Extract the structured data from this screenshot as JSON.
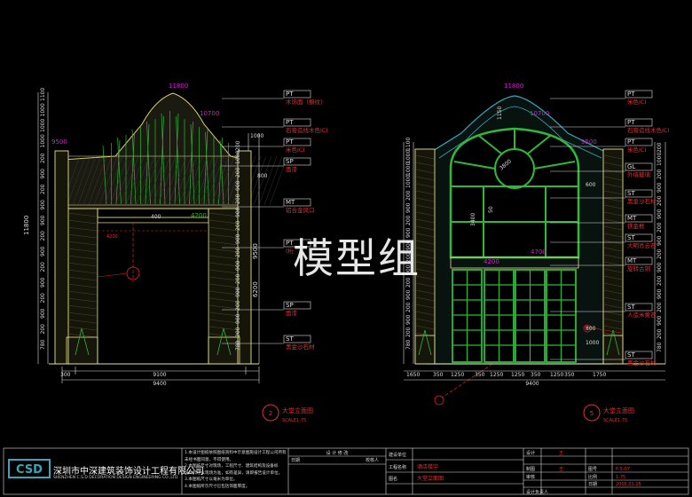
{
  "watermark": "模型组",
  "left_elevation": {
    "top_level": "11800",
    "level_2": "10700",
    "level_3": "9500",
    "level_4": "4200",
    "dim_height_total": "11800",
    "dim_9500": "9500",
    "dim_6200": "6200",
    "dim_800": "800",
    "dim_1000": "1000",
    "dim_400": "400",
    "dim_300": "300",
    "dim_9100": "9100",
    "dim_9400": "9400",
    "callouts": [
      {
        "code": "PT",
        "text": "木饰面（橱纹）"
      },
      {
        "code": "PT",
        "text": "石膏造线木色ICI"
      },
      {
        "code": "PT",
        "text": "米色ICI"
      },
      {
        "code": "SP",
        "text": "面漆"
      },
      {
        "code": "MT",
        "text": "铝合金风口"
      },
      {
        "code": "PT",
        "text": "(桁"
      },
      {
        "code": "SP",
        "text": "面漆"
      },
      {
        "code": "ST",
        "text": "黑金沙石材"
      }
    ],
    "left_dims": [
      "1100",
      "1000",
      "1000",
      "1000",
      "200",
      "900",
      "200",
      "900",
      "900",
      "200",
      "900",
      "200",
      "900",
      "200",
      "900",
      "200",
      "780"
    ],
    "right_dims": [
      "200",
      "1000",
      "200",
      "900",
      "200",
      "900",
      "200",
      "900",
      "200",
      "900",
      "200",
      "900",
      "200",
      "900",
      "200",
      "780"
    ],
    "marker_num": "2",
    "title": "大堂立面图",
    "scale": "SCALE1:75"
  },
  "right_elevation": {
    "top_level": "11800",
    "level_2": "10700",
    "level_3": "9500",
    "level_4": "4700",
    "level_5": "4200",
    "dims_bottom": [
      "1650",
      "350",
      "1250",
      "350",
      "1250",
      "1250",
      "350",
      "1250",
      "350",
      "1750"
    ],
    "dim_9400": "9400",
    "dim_3800": "3800",
    "dim_1150": "1150",
    "dim_3400": "3400",
    "dim_600": "600",
    "dim_800": "800",
    "dim_1000": "1000",
    "dim_50": "50",
    "callouts": [
      {
        "code": "PT",
        "text": "米色ICI"
      },
      {
        "code": "PT",
        "text": "石膏造线木色ICI"
      },
      {
        "code": "PT",
        "text": "米色ICI"
      },
      {
        "code": "GL",
        "text": "外墙玻璃"
      },
      {
        "code": "ST",
        "text": "黑金沙石材"
      },
      {
        "code": "MT",
        "text": "铁金框"
      },
      {
        "code": "ST",
        "text": "大明肖云石"
      },
      {
        "code": "MT",
        "text": "旋转古铜"
      },
      {
        "code": "ST",
        "text": "人造米黄石"
      },
      {
        "code": "ST",
        "text": "黑金沙石材"
      }
    ],
    "marker_num": "5",
    "title": "大堂立面图",
    "scale": "SCALE1:75"
  },
  "title_block": {
    "company_cn": "深圳市中深建筑装饰设计工程有限公司",
    "company_en": "SHENZHEN C.S.D DECORATION DESIGN ENGINEERING CO.,LTD",
    "logo": "CSD",
    "notes": [
      "1.本设计图纸依照图纸资料中示意图施设计工程公司所有",
      "未经书面同意，不得使用。",
      "2.本图纸尺寸对现场，工程尺寸、建筑结构及设备标",
      "设计尺寸以现场为准，如有差异，请即报告设计单位。",
      "3.本图纸尺寸以毫米为单位。",
      "4.本图纸所示尺寸已包括饰面厚度。"
    ],
    "revision_header": "设 计 修 改",
    "date_label": "日期",
    "check_label": "校核人",
    "unit_label": "建设单位",
    "project_label": "工程名称",
    "project_value": "酒店楼宇",
    "drawing_label": "图名",
    "drawing_value": "大堂立面图",
    "design_label": "设计",
    "draw_label": "制图",
    "review_label": "审核",
    "lead_label": "设计负责人",
    "sheet_label": "图号",
    "ratio_label": "比例",
    "date2_label": "日期",
    "sheet_value": "F-5-07",
    "ratio_value": "1:75",
    "date_value": "2005.01.25",
    "sign_design": "王",
    "sign_draw": "王"
  }
}
